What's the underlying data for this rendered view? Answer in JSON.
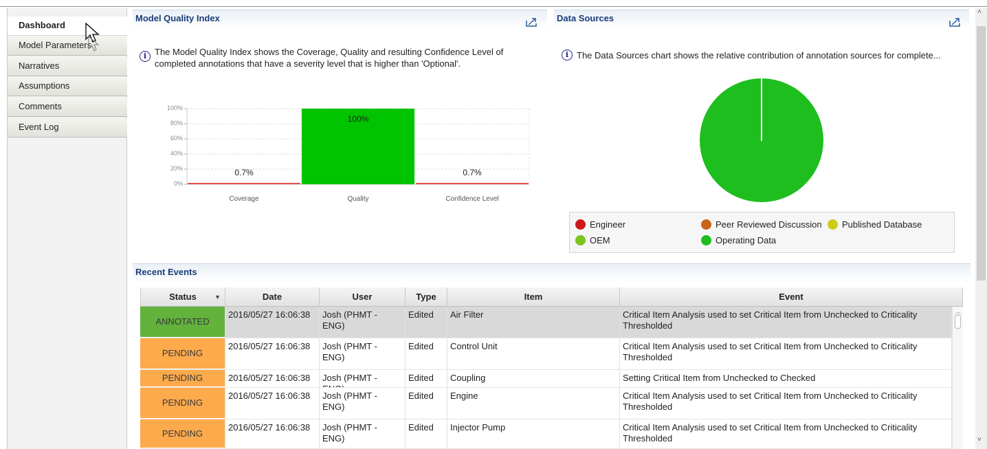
{
  "sidebar": {
    "items": [
      {
        "label": "Dashboard",
        "active": true
      },
      {
        "label": "Model Parameters"
      },
      {
        "label": "Narratives"
      },
      {
        "label": "Assumptions"
      },
      {
        "label": "Comments"
      },
      {
        "label": "Event Log"
      }
    ]
  },
  "mqi": {
    "title": "Model Quality Index",
    "description_line1": "The Model Quality Index shows the Coverage, Quality and resulting Confidence Level of",
    "description_line2": "completed annotations that have a severity level that is higher than 'Optional'.",
    "info_icon_glyph": "i",
    "chart_data": {
      "type": "bar",
      "categories": [
        "Coverage",
        "Quality",
        "Confidence Level"
      ],
      "values": [
        0.7,
        100,
        0.7
      ],
      "data_labels": [
        "0.7%",
        "100%",
        "0.7%"
      ],
      "y_ticks": [
        "0%",
        "20%",
        "40%",
        "60%",
        "80%",
        "100%"
      ],
      "ylim": [
        0,
        100
      ],
      "bar_colors": [
        "#e05050",
        "#00c400",
        "#e05050"
      ],
      "grid": true
    }
  },
  "data_sources": {
    "title": "Data Sources",
    "description": "The Data Sources chart shows the relative contribution of annotation sources for complete...",
    "info_icon_glyph": "i",
    "chart_data": {
      "type": "pie",
      "slices": [
        {
          "name": "Engineer",
          "value": 0,
          "color": "#cc1a1a"
        },
        {
          "name": "Peer Reviewed Discussion",
          "value": 0,
          "color": "#c8641a"
        },
        {
          "name": "Published Database",
          "value": 0,
          "color": "#cccc1a"
        },
        {
          "name": "OEM",
          "value": 0,
          "color": "#7cc41e"
        },
        {
          "name": "Operating Data",
          "value": 100,
          "color": "#1ebe1e"
        }
      ],
      "legend_placement": "bottom"
    },
    "legend": [
      {
        "label": "Engineer",
        "color": "#cc1a1a"
      },
      {
        "label": "Peer Reviewed Discussion",
        "color": "#c8641a"
      },
      {
        "label": "Published Database",
        "color": "#cccc1a"
      },
      {
        "label": "OEM",
        "color": "#7cc41e"
      },
      {
        "label": "Operating Data",
        "color": "#1ebe1e"
      }
    ]
  },
  "recent_events": {
    "title": "Recent Events",
    "columns": [
      "Status",
      "Date",
      "User",
      "Type",
      "Item",
      "Event"
    ],
    "sort_indicator": "▼",
    "status_colors": {
      "ANNOTATED": "#62b23c",
      "PENDING": "#fcaa4c"
    },
    "rows": [
      {
        "status": "ANNOTATED",
        "date": "2016/05/27 16:06:38",
        "user": "Josh (PHMT - ENG)",
        "type": "Edited",
        "item": "Air Filter",
        "event": "Critical Item Analysis used to set Critical Item from Unchecked to Criticality Thresholded"
      },
      {
        "status": "PENDING",
        "date": "2016/05/27 16:06:38",
        "user": "Josh (PHMT - ENG)",
        "type": "Edited",
        "item": "Control Unit",
        "event": "Critical Item Analysis used to set Critical Item from Unchecked to Criticality Thresholded"
      },
      {
        "status": "PENDING",
        "date": "2016/05/27 16:06:38",
        "user": "Josh (PHMT - ENG)",
        "type": "Edited",
        "item": "Coupling",
        "event": "Setting Critical Item from Unchecked to Checked"
      },
      {
        "status": "PENDING",
        "date": "2016/05/27 16:06:38",
        "user": "Josh (PHMT - ENG)",
        "type": "Edited",
        "item": "Engine",
        "event": "Critical Item Analysis used to set Critical Item from Unchecked to Criticality Thresholded"
      },
      {
        "status": "PENDING",
        "date": "2016/05/27 16:06:38",
        "user": "Josh (PHMT - ENG)",
        "type": "Edited",
        "item": "Injector Pump",
        "event": "Critical Item Analysis used to set Critical Item from Unchecked to Criticality Thresholded"
      }
    ]
  }
}
